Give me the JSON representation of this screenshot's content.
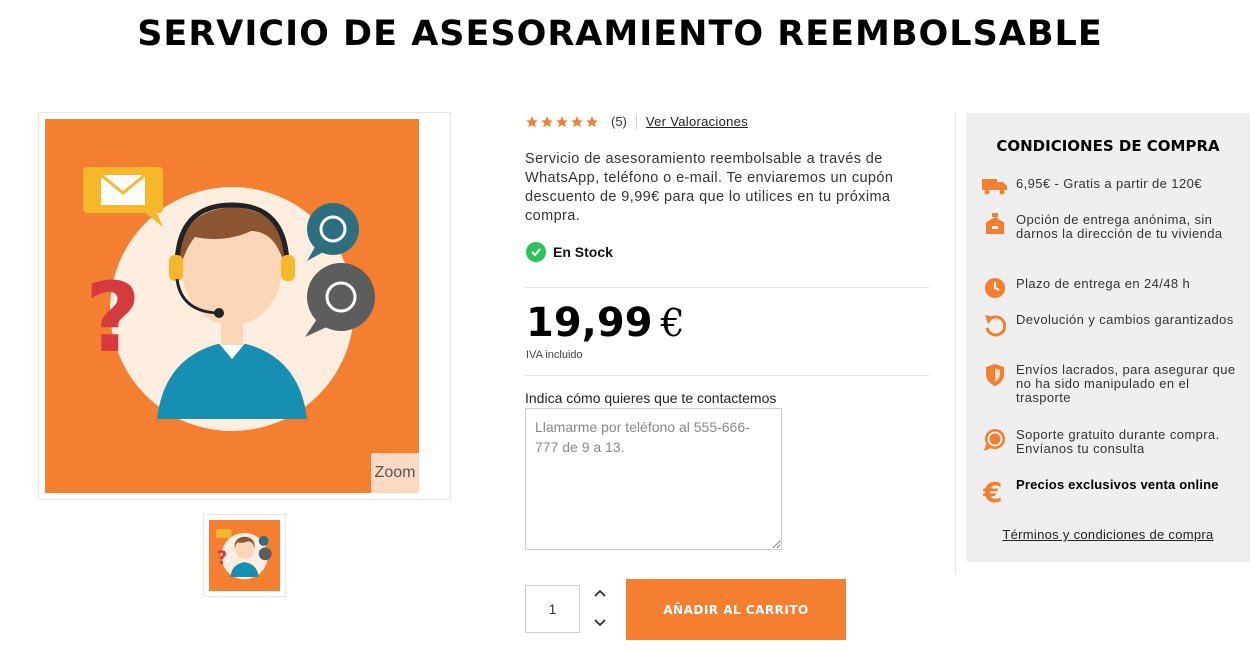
{
  "page": {
    "title": "SERVICIO DE ASESORAMIENTO REEMBOLSABLE"
  },
  "gallery": {
    "zoom_label": "Zoom"
  },
  "rating": {
    "stars": 5,
    "count": "(5)",
    "reviews_link": "Ver Valoraciones"
  },
  "product": {
    "description": "Servicio de asesoramiento reembolsable a través de WhatsApp, teléfono o e-mail. Te enviaremos un cupón descuento de 9,99€ para que lo utilices en tu próxima compra.",
    "stock": "En Stock",
    "price": "19,99",
    "currency": "€",
    "vat_note": "IVA incluido"
  },
  "contact": {
    "label": "Indica cómo quieres que te contactemos",
    "placeholder": "Llamarme por teléfono al 555-666-777 de 9 a 13."
  },
  "cart": {
    "quantity": "1",
    "add_button": "AÑADIR AL CARRITO"
  },
  "conditions": {
    "title": "CONDICIONES DE COMPRA",
    "items": [
      {
        "icon": "truck-icon",
        "text": "6,95€ - Gratis a partir de 120€"
      },
      {
        "icon": "anonymous-box-icon",
        "text": "Opción de entrega anónima, sin darnos la dirección de tu vivienda"
      },
      {
        "icon": "clock-icon",
        "text": "Plazo de entrega en 24/48 h"
      },
      {
        "icon": "return-arrow-icon",
        "text": "Devolución y cambios garantizados"
      },
      {
        "icon": "shield-icon",
        "text": "Envíos lacrados, para asegurar que no ha sido manipulado en el trasporte"
      },
      {
        "icon": "whatsapp-icon",
        "text": "Soporte gratuito durante compra. Envíanos tu consulta"
      },
      {
        "icon": "euro-icon",
        "text": "Precios exclusivos venta online"
      }
    ],
    "terms_link": "Términos y condiciones de compra"
  },
  "colors": {
    "accent": "#f47f30",
    "stock_green": "#2ec35a",
    "panel_bg": "#efefef"
  }
}
